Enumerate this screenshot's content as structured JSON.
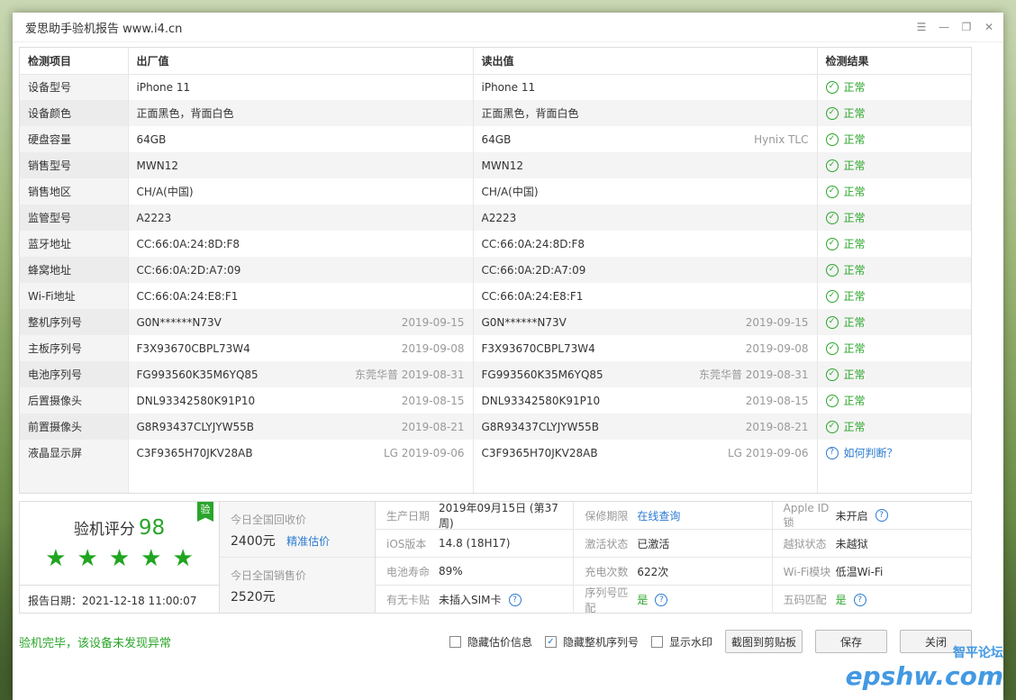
{
  "window": {
    "title": "爱思助手验机报告 www.i4.cn"
  },
  "table": {
    "headers": [
      "检测项目",
      "出厂值",
      "读出值",
      "检测结果"
    ],
    "rows": [
      {
        "name": "设备型号",
        "factory": "iPhone 11",
        "factory_sub": "",
        "read": "iPhone 11",
        "read_sub": "",
        "result": "正常"
      },
      {
        "name": "设备颜色",
        "factory": "正面黑色，背面白色",
        "factory_sub": "",
        "read": "正面黑色，背面白色",
        "read_sub": "",
        "result": "正常"
      },
      {
        "name": "硬盘容量",
        "factory": "64GB",
        "factory_sub": "",
        "read": "64GB",
        "read_sub": "Hynix TLC",
        "result": "正常"
      },
      {
        "name": "销售型号",
        "factory": "MWN12",
        "factory_sub": "",
        "read": "MWN12",
        "read_sub": "",
        "result": "正常"
      },
      {
        "name": "销售地区",
        "factory": "CH/A(中国)",
        "factory_sub": "",
        "read": "CH/A(中国)",
        "read_sub": "",
        "result": "正常"
      },
      {
        "name": "监管型号",
        "factory": "A2223",
        "factory_sub": "",
        "read": "A2223",
        "read_sub": "",
        "result": "正常"
      },
      {
        "name": "蓝牙地址",
        "factory": "CC:66:0A:24:8D:F8",
        "factory_sub": "",
        "read": "CC:66:0A:24:8D:F8",
        "read_sub": "",
        "result": "正常"
      },
      {
        "name": "蜂窝地址",
        "factory": "CC:66:0A:2D:A7:09",
        "factory_sub": "",
        "read": "CC:66:0A:2D:A7:09",
        "read_sub": "",
        "result": "正常"
      },
      {
        "name": "Wi-Fi地址",
        "factory": "CC:66:0A:24:E8:F1",
        "factory_sub": "",
        "read": "CC:66:0A:24:E8:F1",
        "read_sub": "",
        "result": "正常"
      },
      {
        "name": "整机序列号",
        "factory": "G0N******N73V",
        "factory_sub": "2019-09-15",
        "read": "G0N******N73V",
        "read_sub": "2019-09-15",
        "result": "正常"
      },
      {
        "name": "主板序列号",
        "factory": "F3X93670CBPL73W4",
        "factory_sub": "2019-09-08",
        "read": "F3X93670CBPL73W4",
        "read_sub": "2019-09-08",
        "result": "正常"
      },
      {
        "name": "电池序列号",
        "factory": "FG993560K35M6YQ85",
        "factory_sub": "东莞华普 2019-08-31",
        "read": "FG993560K35M6YQ85",
        "read_sub": "东莞华普 2019-08-31",
        "result": "正常"
      },
      {
        "name": "后置摄像头",
        "factory": "DNL93342580K91P10",
        "factory_sub": "2019-08-15",
        "read": "DNL93342580K91P10",
        "read_sub": "2019-08-15",
        "result": "正常"
      },
      {
        "name": "前置摄像头",
        "factory": "G8R93437CLYJYW55B",
        "factory_sub": "2019-08-21",
        "read": "G8R93437CLYJYW55B",
        "read_sub": "2019-08-21",
        "result": "正常"
      },
      {
        "name": "液晶显示屏",
        "factory": "C3F9365H70JKV28AB",
        "factory_sub": "LG 2019-09-06",
        "read": "C3F9365H70JKV28AB",
        "read_sub": "LG 2019-09-06",
        "result": "如何判断？",
        "result_link": true
      }
    ]
  },
  "summary": {
    "score_label": "验机评分",
    "score": "98",
    "badge": "验",
    "stars": 5,
    "report_date": "报告日期：2021-12-18 11:00:07",
    "recycle_label": "今日全国回收价",
    "recycle_price": "2400元",
    "recycle_link": "精准估价",
    "sale_label": "今日全国销售价",
    "sale_price": "2520元",
    "grid": [
      {
        "label": "生产日期",
        "value": "2019年09月15日 (第37周)"
      },
      {
        "label": "保修期限",
        "value": "在线查询",
        "link": true
      },
      {
        "label": "Apple ID锁",
        "value": "未开启",
        "help": true
      },
      {
        "label": "iOS版本",
        "value": "14.8 (18H17)"
      },
      {
        "label": "激活状态",
        "value": "已激活"
      },
      {
        "label": "越狱状态",
        "value": "未越狱"
      },
      {
        "label": "电池寿命",
        "value": "89%"
      },
      {
        "label": "充电次数",
        "value": "622次"
      },
      {
        "label": "Wi-Fi模块",
        "value": "低温Wi-Fi"
      },
      {
        "label": "有无卡贴",
        "value": "未插入SIM卡",
        "help": true
      },
      {
        "label": "序列号匹配",
        "value": "是",
        "green": true,
        "help": true
      },
      {
        "label": "五码匹配",
        "value": "是",
        "green": true,
        "help": true
      }
    ]
  },
  "footer": {
    "status": "验机完毕，该设备未发现异常",
    "opt_hide_price": "隐藏估价信息",
    "opt_hide_serial": "隐藏整机序列号",
    "opt_watermark": "显示水印",
    "btn_screenshot": "截图到剪贴板",
    "btn_save": "保存",
    "btn_close": "关闭"
  },
  "watermark": {
    "brand": "epshw.com",
    "sub": "智平论坛"
  },
  "colors": {
    "ok_green": "#2aa52a",
    "link_blue": "#2b7ad0"
  }
}
